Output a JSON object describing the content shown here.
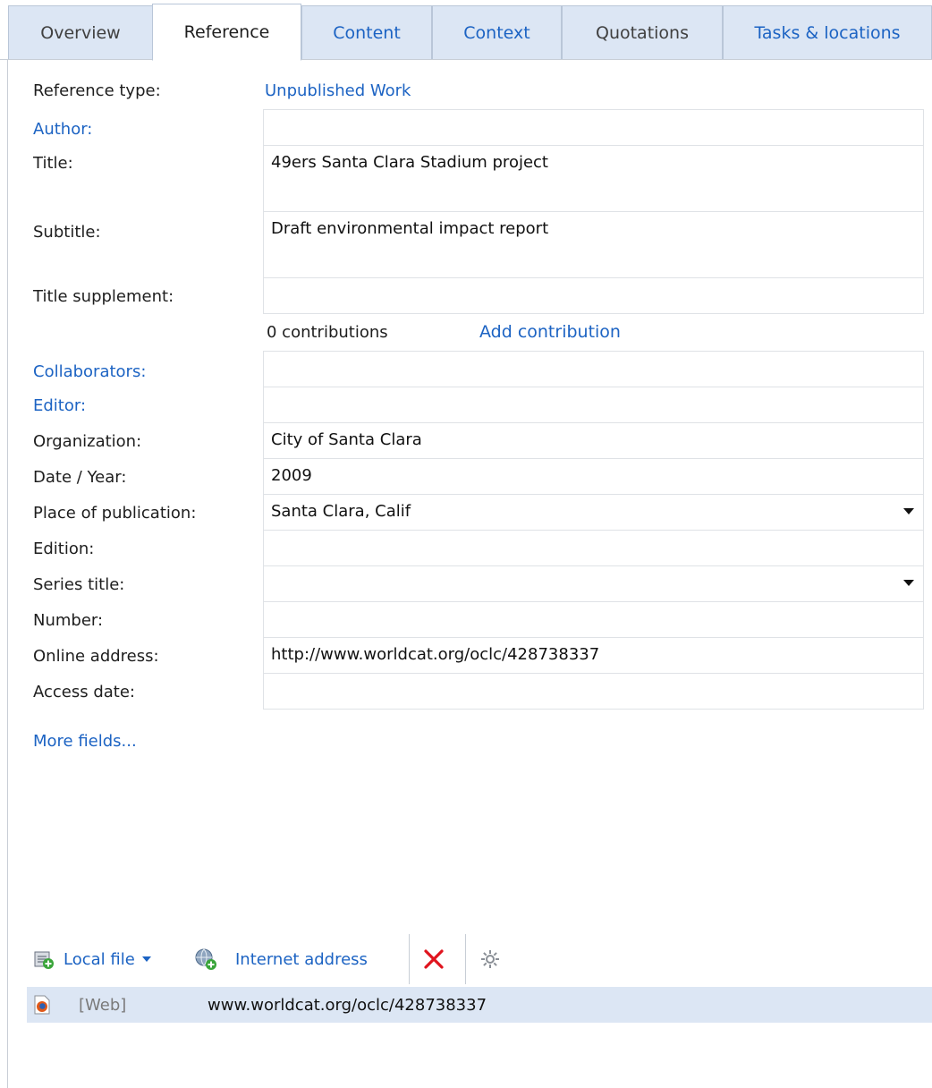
{
  "tabs": [
    {
      "label": "Overview",
      "active": false
    },
    {
      "label": "Reference",
      "active": true
    },
    {
      "label": "Content",
      "active": false
    },
    {
      "label": "Context",
      "active": false
    },
    {
      "label": "Quotations",
      "active": false
    },
    {
      "label": "Tasks & locations",
      "active": false
    }
  ],
  "reference": {
    "type_label": "Reference type:",
    "type_value": "Unpublished Work",
    "author_label": "Author:",
    "author_value": "",
    "title_label": "Title:",
    "title_value": "49ers Santa Clara Stadium project",
    "subtitle_label": "Subtitle:",
    "subtitle_value": "Draft environmental impact report",
    "title_supplement_label": "Title supplement:",
    "title_supplement_value": "",
    "contributions_count": "0 contributions",
    "add_contribution": "Add contribution",
    "collaborators_label": "Collaborators:",
    "collaborators_value": "",
    "editor_label": "Editor:",
    "editor_value": "",
    "organization_label": "Organization:",
    "organization_value": "City of Santa Clara",
    "date_label": "Date / Year:",
    "date_value": "2009",
    "place_label": "Place of publication:",
    "place_value": "Santa Clara, Calif",
    "edition_label": "Edition:",
    "edition_value": "",
    "series_label": "Series title:",
    "series_value": "",
    "number_label": "Number:",
    "number_value": "",
    "online_label": "Online address:",
    "online_value": "http://www.worldcat.org/oclc/428738337",
    "access_label": "Access date:",
    "access_value": "",
    "more_fields": "More fields..."
  },
  "locations": {
    "local_file": "Local file",
    "internet_address": "Internet address",
    "icons": [
      "local-file-icon",
      "dropdown-caret-icon",
      "internet-address-icon",
      "delete-icon",
      "settings-gear-icon"
    ],
    "rows": [
      {
        "type": "[Web]",
        "address": "www.worldcat.org/oclc/428738337",
        "icon": "firefox-icon"
      }
    ]
  },
  "colors": {
    "link": "#1c63c3",
    "tab_bg": "#dce6f4",
    "selection_bg": "#dce6f4",
    "delete": "#e0141e"
  }
}
